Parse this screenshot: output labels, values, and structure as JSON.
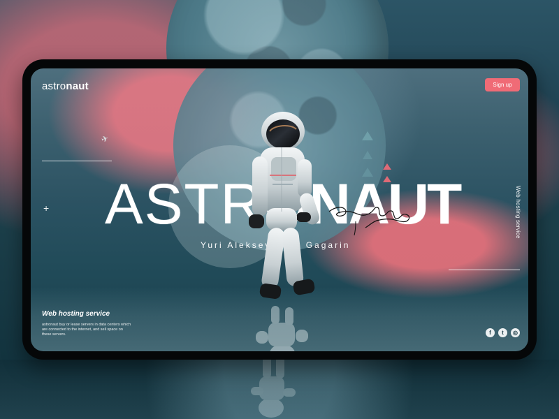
{
  "header": {
    "logo": {
      "light": "astro",
      "bold": "naut"
    },
    "signup_label": "Sign up"
  },
  "hero": {
    "title_light": "ASTRO",
    "title_bold": "NAUT",
    "subtitle": "Yuri Alekseyevich Gagarin",
    "side_text": "Web hosting service"
  },
  "footer": {
    "title": "Web hosting service",
    "description": "astronaut buy or lease servers in data centers which are connected to the internet, and sell space on these servers."
  },
  "social": [
    {
      "icon": "facebook-icon",
      "label": "f"
    },
    {
      "icon": "twitter-icon",
      "label": "t"
    },
    {
      "icon": "instagram-icon",
      "label": "◎"
    }
  ],
  "colors": {
    "accent": "#f06b76",
    "text": "#ffffff",
    "frame": "#050708"
  }
}
